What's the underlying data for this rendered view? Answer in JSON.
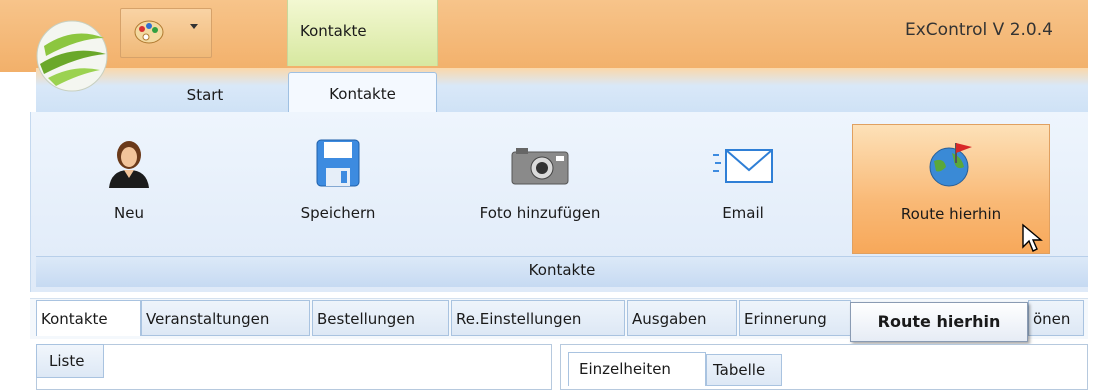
{
  "window": {
    "title": "ExControl V 2.0.4",
    "context_tab": "Kontakte"
  },
  "ribbon_tabs": [
    {
      "label": "Start"
    },
    {
      "label": "Kontakte",
      "active": true
    }
  ],
  "ribbon": {
    "buttons": [
      {
        "label": "Neu",
        "icon": "person-icon"
      },
      {
        "label": "Speichern",
        "icon": "floppy-disk-icon"
      },
      {
        "label": "Foto hinzufügen",
        "icon": "camera-icon"
      },
      {
        "label": "Email",
        "icon": "envelope-icon"
      },
      {
        "label": "Route hierhin",
        "icon": "globe-flag-icon",
        "hovered": true
      }
    ],
    "group_label": "Kontakte"
  },
  "document_tabs": [
    "Kontakte",
    "Veranstaltungen",
    "Bestellungen",
    "Re.Einstellungen",
    "Ausgaben",
    "Erinnerung",
    "önen"
  ],
  "tooltip": "Route hierhin",
  "panes": {
    "left_tab": "Liste",
    "right_tabs": [
      "Einzelheiten",
      "Tabelle"
    ]
  },
  "colors": {
    "accent_orange": "#f2b06a",
    "ribbon_blue": "#dfeaf8",
    "context_green": "#d7e8a0"
  }
}
